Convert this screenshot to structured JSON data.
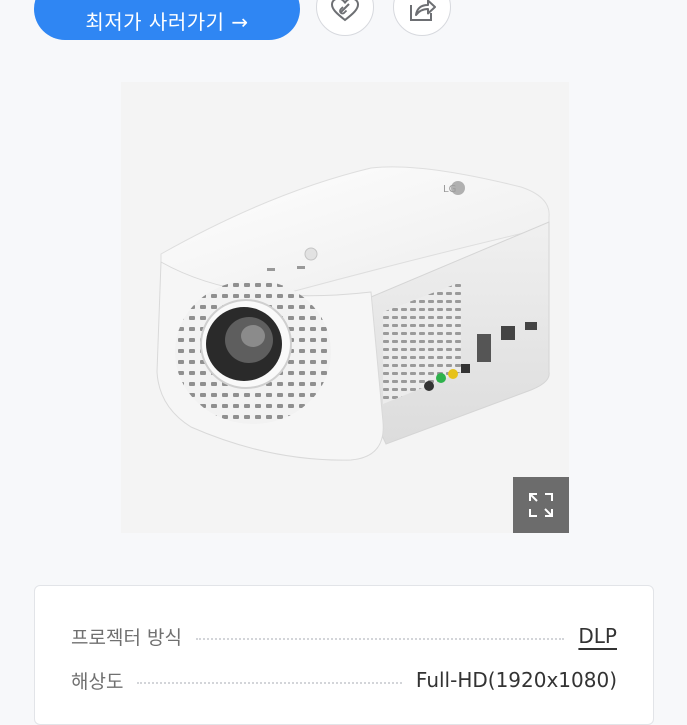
{
  "actions": {
    "buy_label": "최저가 사러가기 →"
  },
  "colors": {
    "primary_button": "#2f86f3",
    "expand_button": "#6c6c6c"
  },
  "icons": {
    "wish": "heart-link-icon",
    "share": "share-icon",
    "expand": "expand-icon"
  },
  "product": {
    "brand_mark": "LG"
  },
  "specs": [
    {
      "label": "프로젝터 방식",
      "value": "DLP"
    },
    {
      "label": "해상도",
      "value": "Full-HD(1920x1080)"
    }
  ]
}
